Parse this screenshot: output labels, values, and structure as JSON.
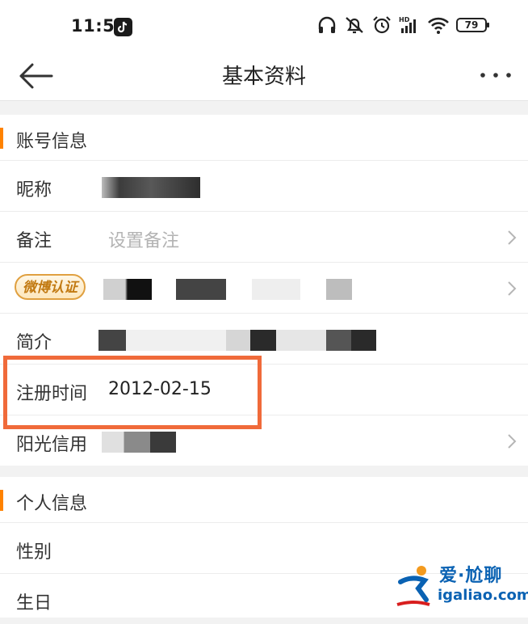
{
  "status_bar": {
    "time": "11:55",
    "battery": "79",
    "icons": [
      "tiktok-icon",
      "headphones-icon",
      "mute-icon",
      "alarm-icon",
      "signal-icon",
      "wifi-icon",
      "battery-icon"
    ]
  },
  "nav": {
    "title": "基本资料",
    "back_icon": "back-arrow-icon",
    "more_icon": "more-icon"
  },
  "account_section": {
    "title": "账号信息",
    "rows": {
      "nickname": {
        "label": "昵称"
      },
      "remark": {
        "label": "备注",
        "placeholder": "设置备注"
      },
      "verify": {
        "badge": "微博认证"
      },
      "intro": {
        "label": "简介"
      },
      "register": {
        "label": "注册时间",
        "value": "2012-02-15"
      },
      "credit": {
        "label": "阳光信用"
      }
    }
  },
  "personal_section": {
    "title": "个人信息",
    "rows": {
      "gender": {
        "label": "性别"
      },
      "birthday": {
        "label": "生日"
      }
    }
  },
  "watermark": {
    "cn": "爱·尬聊",
    "url": "igaliao.com"
  },
  "colors": {
    "accent": "#ff8200",
    "highlight": "#f06a3a",
    "watermark": "#0a62b3"
  }
}
